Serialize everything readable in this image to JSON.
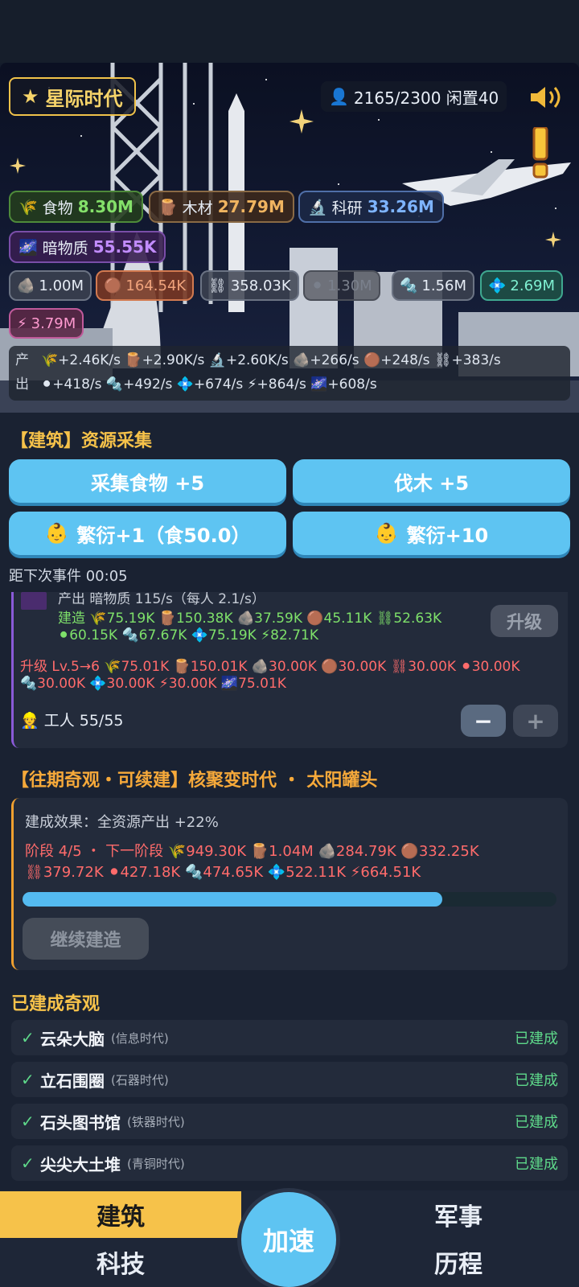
{
  "era": {
    "label": "星际时代"
  },
  "population": {
    "text": "2165/2300 闲置40"
  },
  "resources": {
    "food": {
      "label": "食物",
      "value": "8.30M"
    },
    "wood": {
      "label": "木材",
      "value": "27.79M"
    },
    "science": {
      "label": "科研",
      "value": "33.26M"
    },
    "dark_matter": {
      "label": "暗物质",
      "value": "55.55K"
    }
  },
  "materials": [
    {
      "icon": "stone-icon",
      "value": "1.00M"
    },
    {
      "icon": "copper-icon",
      "value": "164.54K"
    },
    {
      "icon": "chain-icon",
      "value": "358.03K"
    },
    {
      "icon": "coal-icon",
      "value": "1.30M"
    },
    {
      "icon": "tool-icon",
      "value": "1.56M"
    },
    {
      "icon": "crystal-icon",
      "value": "2.69M"
    },
    {
      "icon": "energy-icon",
      "value": "3.79M"
    }
  ],
  "production": {
    "label_line1": "产",
    "label_line2": "出",
    "line1": "🌾+2.46K/s 🪵+2.90K/s 🔬+2.60K/s 🪨+266/s 🟤+248/s ⛓+383/s",
    "line2": "⚫+418/s 🔩+492/s 💠+674/s ⚡+864/s 🌌+608/s"
  },
  "building_section": {
    "title": "【建筑】资源采集"
  },
  "actions": {
    "gather_food": "采集食物 +5",
    "chop_wood": "伐木 +5",
    "breed_one": "繁衍+1（食50.0）",
    "breed_ten": "繁衍+10"
  },
  "event_timer": "距下次事件 00:05",
  "building_card": {
    "partial_line": "产出 暗物质 115/s（每人 2.1/s）",
    "build_cost_line1": "建造 🌾75.19K 🪵150.38K 🪨37.59K 🟤45.11K ⛓52.63K",
    "build_cost_line2": "⚫60.15K 🔩67.67K 💠75.19K ⚡82.71K",
    "upgrade_line1": "升级 Lv.5→6 🌾75.01K 🪵150.01K 🪨30.00K 🟤30.00K ⛓30.00K ⚫30.00K",
    "upgrade_line2": "🔩30.00K 💠30.00K ⚡30.00K 🌌75.01K",
    "upgrade_button": "升级",
    "workers": "工人 55/55",
    "minus": "−",
    "plus": "+"
  },
  "wonder": {
    "title": "【往期奇观・可续建】核聚变时代 ・ 太阳罐头",
    "effect": "建成效果：全资源产出 +22%",
    "stage_line1": "阶段 4/5 ・ 下一阶段 🌾949.30K 🪵1.04M 🪨284.79K 🟤332.25K",
    "stage_line2": "⛓379.72K ⚫427.18K 🔩474.65K 💠522.11K ⚡664.51K",
    "progress": 0.786,
    "continue_button": "继续建造"
  },
  "built_wonders": {
    "title": "已建成奇观",
    "items": [
      {
        "name": "云朵大脑",
        "era": "(信息时代)",
        "status": "已建成"
      },
      {
        "name": "立石围圈",
        "era": "(石器时代)",
        "status": "已建成"
      },
      {
        "name": "石头图书馆",
        "era": "(铁器时代)",
        "status": "已建成"
      },
      {
        "name": "尖尖大土堆",
        "era": "(青铜时代)",
        "status": "已建成"
      }
    ]
  },
  "nav": {
    "building": "建筑",
    "military": "军事",
    "tech": "科技",
    "history": "历程",
    "speed": "加速"
  },
  "colors": {
    "accent": "#f6c24a",
    "button": "#5ec4f2",
    "built": "#5ed88a",
    "cost_red": "#ff6b6b"
  }
}
